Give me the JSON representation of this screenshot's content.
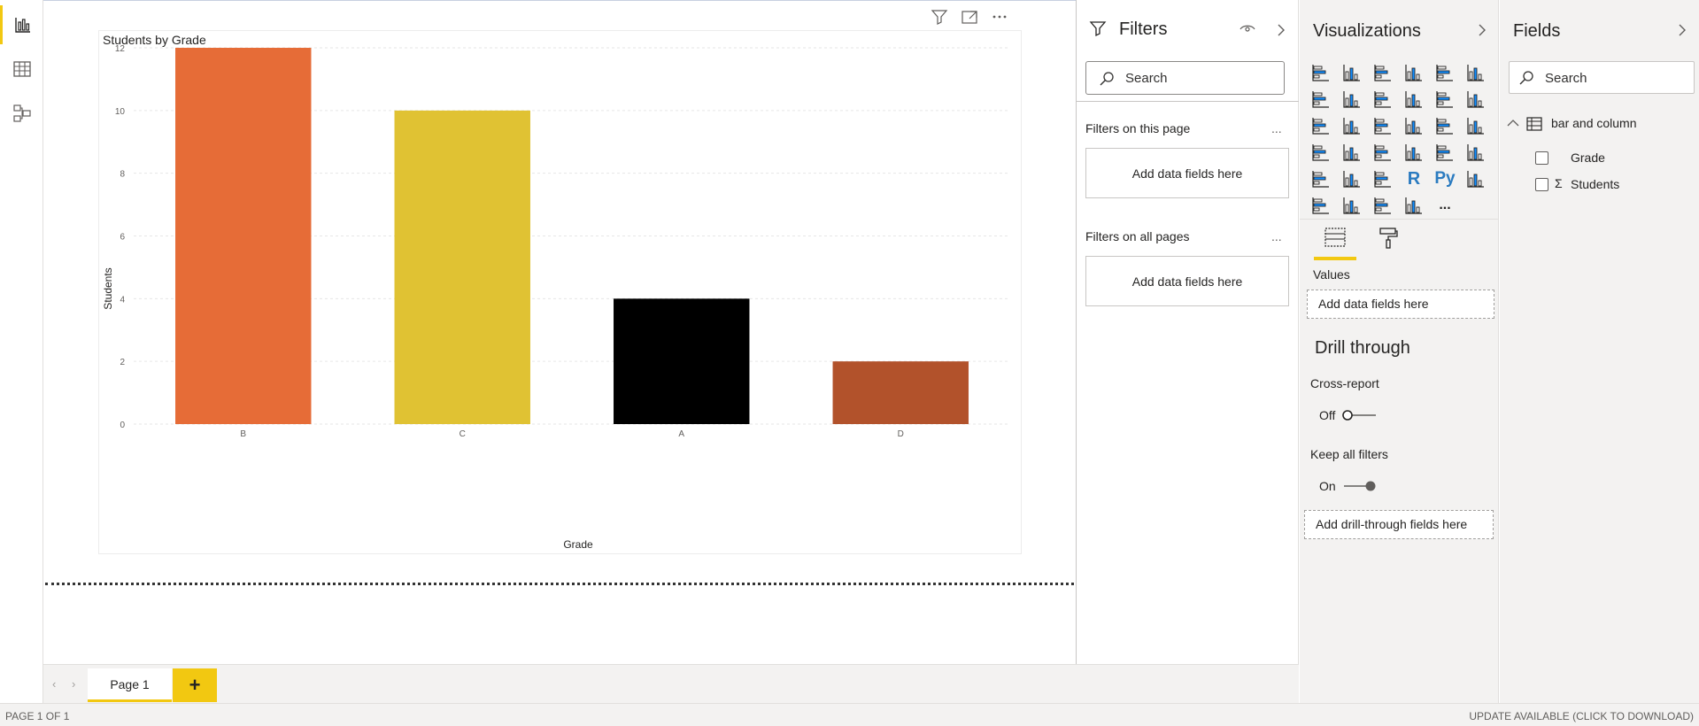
{
  "left_rail": {
    "items": [
      {
        "name": "report-view",
        "active": true
      },
      {
        "name": "data-view",
        "active": false
      },
      {
        "name": "model-view",
        "active": false
      }
    ]
  },
  "visual": {
    "header_icons": [
      "filter-icon",
      "focus-mode-icon",
      "more-options-icon"
    ]
  },
  "chart_data": {
    "type": "bar",
    "title": "Students by Grade",
    "xlabel": "Grade",
    "ylabel": "Students",
    "categories": [
      "B",
      "C",
      "A",
      "D"
    ],
    "values": [
      12,
      10,
      4,
      2
    ],
    "colors": [
      "#E66C37",
      "#E0C233",
      "#000000",
      "#B2522B"
    ],
    "ylim": [
      0,
      12
    ],
    "yticks": [
      "0",
      "2",
      "4",
      "6",
      "8",
      "10",
      "12"
    ],
    "grid": true
  },
  "tabs": {
    "page_label": "Page 1",
    "add_label": "+"
  },
  "status": {
    "left": "PAGE 1 OF 1",
    "right": "UPDATE AVAILABLE (CLICK TO DOWNLOAD)"
  },
  "filters": {
    "title": "Filters",
    "search_placeholder": "Search",
    "on_page_label": "Filters on this page",
    "on_page_drop": "Add data fields here",
    "all_pages_label": "Filters on all pages",
    "all_pages_drop": "Add data fields here",
    "more": "..."
  },
  "visualizations": {
    "title": "Visualizations",
    "more_visuals": "...",
    "values_label": "Values",
    "values_drop": "Add data fields here",
    "drill_title": "Drill through",
    "cross_report_label": "Cross-report",
    "cross_report_state": "Off",
    "keep_filters_label": "Keep all filters",
    "keep_filters_state": "On",
    "drill_drop": "Add drill-through fields here",
    "r_label": "R",
    "py_label": "Py"
  },
  "fields": {
    "title": "Fields",
    "search_placeholder": "Search",
    "table_name": "bar and column",
    "items": [
      {
        "label": "Grade",
        "sigma": ""
      },
      {
        "label": "Students",
        "sigma": "Σ"
      }
    ]
  },
  "accent_color": "#F2C811"
}
